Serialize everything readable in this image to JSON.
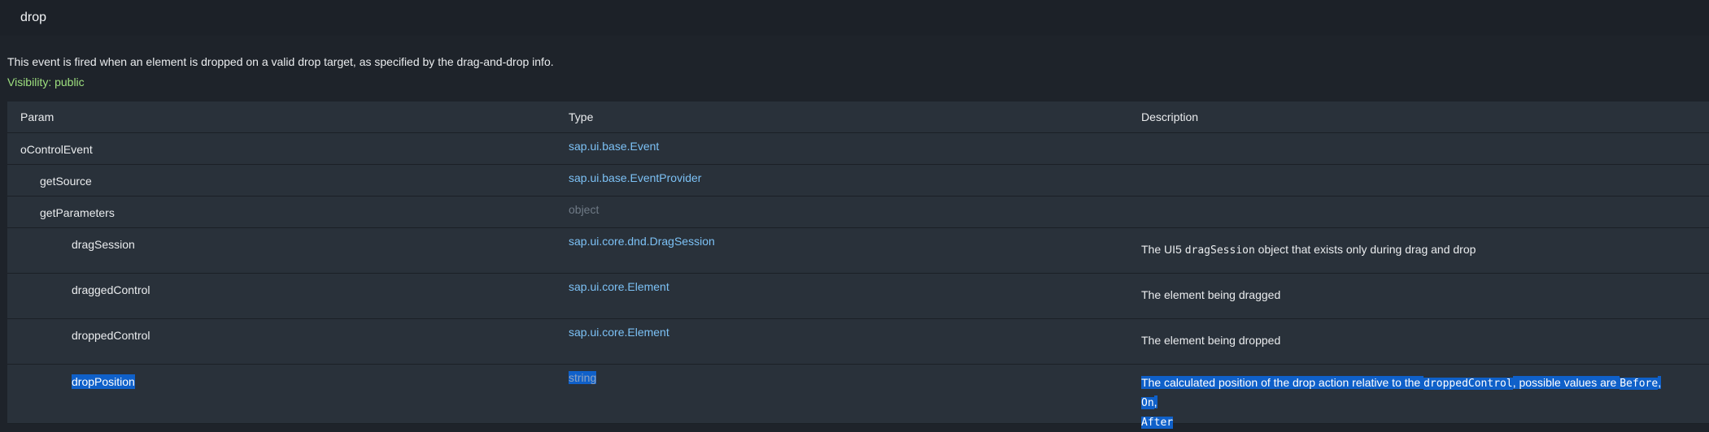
{
  "header": {
    "title": "drop"
  },
  "event": {
    "description": "This event is fired when an element is dropped on a valid drop target, as specified by the drag-and-drop info.",
    "visibility": "Visibility: public"
  },
  "table": {
    "columns": [
      "Param",
      "Type",
      "Description"
    ],
    "rows": [
      {
        "param": "oControlEvent",
        "type": "sap.ui.base.Event"
      },
      {
        "param": "getSource",
        "type": "sap.ui.base.EventProvider"
      },
      {
        "param": "getParameters",
        "type": "object"
      },
      {
        "param": "dragSession",
        "type": "sap.ui.core.dnd.DragSession",
        "desc_pre": "The UI5 ",
        "desc_code": "dragSession",
        "desc_post": " object that exists only during drag and drop"
      },
      {
        "param": "draggedControl",
        "type": "sap.ui.core.Element",
        "desc": "The element being dragged"
      },
      {
        "param": "droppedControl",
        "type": "sap.ui.core.Element",
        "desc": "The element being dropped"
      },
      {
        "param": "dropPosition",
        "type": "string",
        "desc_pre": "The calculated position of the drop action relative to the ",
        "desc_code": "droppedControl",
        "desc_mid": ", possible values are ",
        "desc_v1": "Before",
        "desc_sep1": ", ",
        "desc_v2": "On",
        "desc_sep2": ",",
        "desc_v3": "After"
      }
    ]
  },
  "colors": {
    "link": "#7cc1f5",
    "visibility": "#9ee07f",
    "selection": "#0f60c9"
  }
}
